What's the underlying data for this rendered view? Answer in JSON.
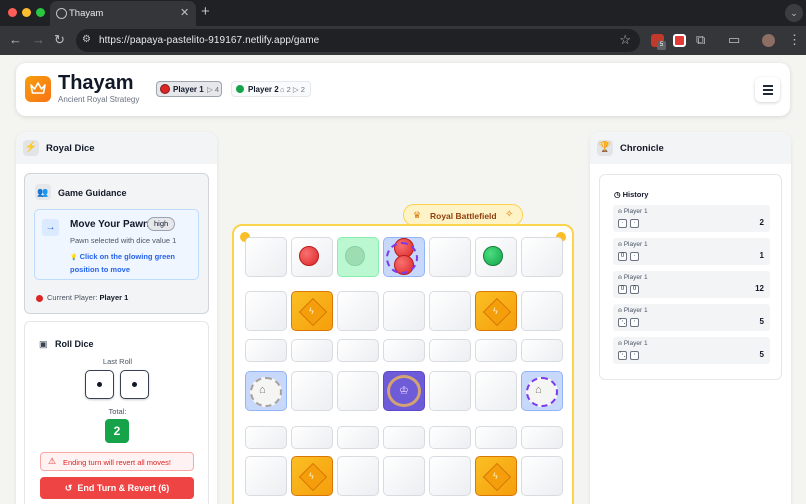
{
  "browser": {
    "tab_title": "Thayam",
    "url": "https://papaya-pastelito-919167.netlify.app/game",
    "extension_badge": "5"
  },
  "header": {
    "title": "Thayam",
    "subtitle": "Ancient Royal Strategy",
    "players": [
      {
        "name": "Player 1",
        "stat": "▷ 4",
        "color": "#dc2626",
        "active": true
      },
      {
        "name": "Player 2",
        "stat": "⌂ 2 ▷ 2",
        "color": "#16a34a",
        "active": false
      }
    ]
  },
  "left_panel": {
    "title": "Royal Dice",
    "guidance": {
      "title": "Game Guidance",
      "move_title": "Move Your Pawn",
      "priority": "high",
      "description": "Pawn selected with dice value 1",
      "hint": "Click on the glowing green position to move",
      "hint_icon": "💡",
      "current_player_label": "Current Player:",
      "current_player": "Player 1"
    },
    "roll": {
      "title": "Roll Dice",
      "last_roll_label": "Last Roll",
      "dice": [
        1,
        1
      ],
      "total_label": "Total:",
      "total": "2",
      "warning": "Ending turn will revert all moves!",
      "end_button": "End Turn & Revert (6)"
    }
  },
  "board": {
    "label": "Royal Battlefield",
    "crown_icon": "♛",
    "spark_icon": "✧"
  },
  "right_panel": {
    "title": "Chronicle",
    "history_title": "History",
    "history": [
      {
        "player": "Player 1",
        "dice": [
          "·",
          "·"
        ],
        "total": "2"
      },
      {
        "player": "Player 1",
        "dice": [
          "0",
          "·"
        ],
        "total": "1"
      },
      {
        "player": "Player 1",
        "dice": [
          "0",
          "0"
        ],
        "total": "12"
      },
      {
        "player": "Player 1",
        "dice": [
          "⋱",
          "⋅"
        ],
        "total": "5"
      },
      {
        "player": "Player 1",
        "dice": [
          "⋱",
          "⋅"
        ],
        "total": "5"
      }
    ]
  },
  "colors": {
    "accent": "#f59e0b",
    "danger": "#ef4444",
    "success": "#16a34a",
    "info": "#2563eb"
  }
}
